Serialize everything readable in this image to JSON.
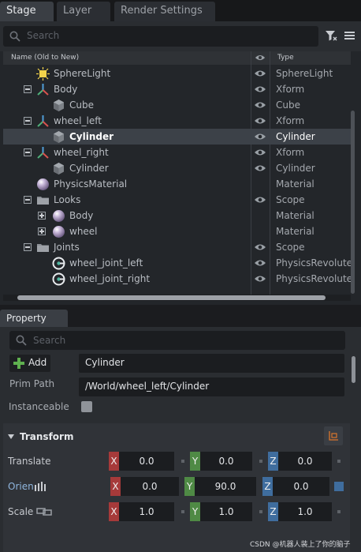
{
  "stage": {
    "tabs": [
      {
        "label": "Stage"
      },
      {
        "label": "Layer"
      },
      {
        "label": "Render Settings"
      }
    ],
    "search_placeholder": "Search",
    "columns": {
      "name": "Name (Old to New)",
      "type": "Type"
    },
    "rows": [
      {
        "name": "SphereLight",
        "type": "SphereLight",
        "icon": "sphere-light-icon",
        "level": 1,
        "expander": "none",
        "visible": true,
        "selected": false
      },
      {
        "name": "Body",
        "type": "Xform",
        "icon": "xform-icon",
        "level": 1,
        "expander": "minus",
        "visible": true,
        "selected": false
      },
      {
        "name": "Cube",
        "type": "Cube",
        "icon": "cube-icon",
        "level": 2,
        "expander": "none",
        "visible": true,
        "selected": false
      },
      {
        "name": "wheel_left",
        "type": "Xform",
        "icon": "xform-icon",
        "level": 1,
        "expander": "minus",
        "visible": true,
        "selected": false
      },
      {
        "name": "Cylinder",
        "type": "Cylinder",
        "icon": "cylinder-icon",
        "level": 2,
        "expander": "none",
        "visible": true,
        "selected": true
      },
      {
        "name": "wheel_right",
        "type": "Xform",
        "icon": "xform-icon",
        "level": 1,
        "expander": "minus",
        "visible": true,
        "selected": false
      },
      {
        "name": "Cylinder",
        "type": "Cylinder",
        "icon": "cylinder-icon",
        "level": 2,
        "expander": "none",
        "visible": true,
        "selected": false
      },
      {
        "name": "PhysicsMaterial",
        "type": "Material",
        "icon": "material-sphere-icon",
        "level": 1,
        "expander": "none",
        "visible": false,
        "selected": false
      },
      {
        "name": "Looks",
        "type": "Scope",
        "icon": "folder-icon",
        "level": 1,
        "expander": "minus",
        "visible": true,
        "selected": false
      },
      {
        "name": "Body",
        "type": "Material",
        "icon": "material-sphere-icon",
        "level": 2,
        "expander": "plus",
        "visible": false,
        "selected": false
      },
      {
        "name": "wheel",
        "type": "Material",
        "icon": "material-sphere-icon",
        "level": 2,
        "expander": "plus",
        "visible": false,
        "selected": false
      },
      {
        "name": "Joints",
        "type": "Scope",
        "icon": "folder-icon",
        "level": 1,
        "expander": "minus",
        "visible": true,
        "selected": false
      },
      {
        "name": "wheel_joint_left",
        "type": "PhysicsRevoluteJoint",
        "icon": "revolute-joint-icon",
        "level": 2,
        "expander": "none",
        "visible": true,
        "selected": false
      },
      {
        "name": "wheel_joint_right",
        "type": "PhysicsRevoluteJoint",
        "icon": "revolute-joint-icon",
        "level": 2,
        "expander": "none",
        "visible": true,
        "selected": false
      }
    ]
  },
  "property": {
    "tab_label": "Property",
    "search_placeholder": "Search",
    "add_label": "Add",
    "prim_name": "Cylinder",
    "prim_path_label": "Prim Path",
    "prim_path": "/World/wheel_left/Cylinder",
    "instanceable_label": "Instanceable",
    "instanceable": false,
    "transform": {
      "title": "Transform",
      "rows": [
        {
          "label": "Translate",
          "x": "0.0",
          "y": "0.0",
          "z": "0.0"
        },
        {
          "label": "Orient",
          "x": "0.0",
          "y": "90.0",
          "z": "0.0"
        },
        {
          "label": "Scale",
          "x": "1.0",
          "y": "1.0",
          "z": "1.0"
        }
      ]
    }
  },
  "colors": {
    "axis_x": "#a63a3a",
    "axis_y": "#4f8a45",
    "axis_z": "#3f6d9e",
    "selection": "#3c4148"
  },
  "watermark": "CSDN @机器人装上了你的脑子"
}
